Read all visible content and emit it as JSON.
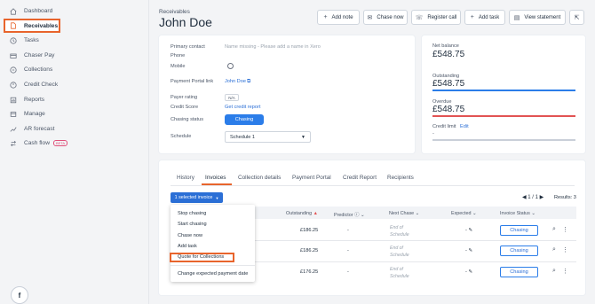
{
  "sidebar": {
    "items": [
      {
        "label": "Dashboard",
        "icon": "home-icon"
      },
      {
        "label": "Receivables",
        "icon": "document-icon",
        "active": true
      },
      {
        "label": "Tasks",
        "icon": "clock-icon"
      },
      {
        "label": "Chaser Pay",
        "icon": "card-icon"
      },
      {
        "label": "Collections",
        "icon": "collections-icon"
      },
      {
        "label": "Credit Check",
        "icon": "credit-icon"
      },
      {
        "label": "Reports",
        "icon": "reports-icon"
      },
      {
        "label": "Manage",
        "icon": "manage-icon"
      },
      {
        "label": "AR forecast",
        "icon": "forecast-icon"
      },
      {
        "label": "Cash flow",
        "icon": "cashflow-icon",
        "badge": "BETA"
      }
    ],
    "chat_glyph": "f"
  },
  "header": {
    "breadcrumb": "Receivables",
    "title": "John Doe",
    "buttons": {
      "add_note": "Add note",
      "chase_now": "Chase now",
      "register_call": "Register call",
      "add_task": "Add task",
      "view_statement": "View statement"
    }
  },
  "contact": {
    "primary_contact_label": "Primary contact",
    "primary_contact_value": "Name missing - Please add a name in Xero",
    "phone_label": "Phone",
    "mobile_label": "Mobile",
    "portal_link_label": "Payment Portal link",
    "portal_link_value": "John Doe",
    "payer_rating_label": "Payer rating",
    "payer_rating_value": "N/A",
    "credit_score_label": "Credit Score",
    "credit_score_value": "Get credit report",
    "chasing_status_label": "Chasing status",
    "chasing_status_value": "Chasing",
    "schedule_label": "Schedule",
    "schedule_value": "Schedule 1"
  },
  "balances": {
    "net_label": "Net balance",
    "net_value": "£548.75",
    "outstanding_label": "Outstanding",
    "outstanding_value": "£548.75",
    "overdue_label": "Overdue",
    "overdue_value": "£548.75",
    "credit_limit_label": "Credit limit",
    "credit_limit_edit": "Edit",
    "credit_limit_value": "-",
    "colors": {
      "outstanding": "#2b7de9",
      "overdue": "#e25353",
      "credit": "#c9cfd8"
    }
  },
  "tabs": [
    "History",
    "Invoices",
    "Collection details",
    "Payment Portal",
    "Credit Report",
    "Recipients"
  ],
  "invoices": {
    "selected_button": "1 selected invoice",
    "pagination": "1 / 1",
    "results": "Results: 3",
    "columns": {
      "outstanding": "Outstanding",
      "predictor": "Predictor",
      "next_chase": "Next Chase",
      "expected": "Expected",
      "status": "Invoice Status"
    },
    "rows": [
      {
        "outstanding": "£186.25",
        "predictor": "-",
        "next_chase": "End of Schedule",
        "expected": "-",
        "status": "Chasing"
      },
      {
        "outstanding": "£186.25",
        "predictor": "-",
        "next_chase": "End of Schedule",
        "expected": "-",
        "status": "Chasing"
      },
      {
        "outstanding": "£176.25",
        "predictor": "-",
        "next_chase": "End of Schedule",
        "expected": "-",
        "status": "Chasing"
      }
    ]
  },
  "dropdown": {
    "items": [
      "Stop chasing",
      "Start chasing",
      "Chase now",
      "Add task",
      "Quote for Collections"
    ],
    "footer": "Change expected payment date"
  }
}
